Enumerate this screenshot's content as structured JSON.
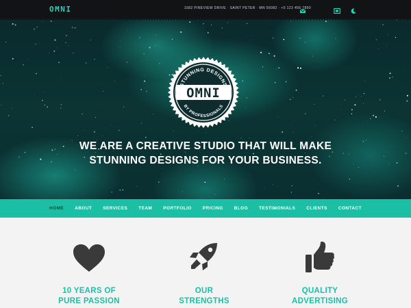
{
  "topbar": {
    "brand": "OMNI",
    "address": "1582 PINEVIEW DRIVE  ·  SAINT PETER  ·  MN 56082  ·  +0 123 456 7890",
    "icons": [
      "envelope-icon",
      "map-icon",
      "moon-icon"
    ]
  },
  "hero": {
    "badge": {
      "top_text": "STUNNING DESIGNS",
      "name": "OMNI",
      "bottom_text": "BY PROFESSIONALS"
    },
    "tagline_line1": "WE ARE A CREATIVE STUDIO THAT WILL MAKE",
    "tagline_line2": "STUNNING DESIGNS FOR YOUR BUSINESS."
  },
  "nav": {
    "items": [
      "HOME",
      "ABOUT",
      "SERVICES",
      "TEAM",
      "PORTFOLIO",
      "PRICING",
      "BLOG",
      "TESTIMONIALS",
      "CLIENTS",
      "CONTACT"
    ],
    "active": "HOME"
  },
  "features": [
    {
      "icon": "heart-icon",
      "line1": "10 YEARS OF",
      "line2": "PURE PASSION"
    },
    {
      "icon": "rocket-icon",
      "line1": "OUR",
      "line2": "STRENGTHS"
    },
    {
      "icon": "thumbs-up-icon",
      "line1": "QUALITY",
      "line2": "ADVERTISING"
    }
  ],
  "colors": {
    "accent": "#1dbfa4",
    "topbar": "#111315",
    "icon_dark": "#3a3a3a",
    "page_bg": "#f3f3f4"
  }
}
